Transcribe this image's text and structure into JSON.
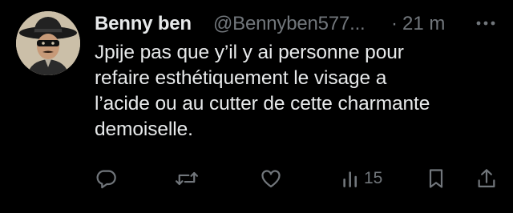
{
  "tweet": {
    "display_name": "Benny ben",
    "handle": "@Bennyben577...",
    "separator": "·",
    "time": "21 m",
    "text": "Jpije pas que y’il y ai personne pour\nrefaire esthétiquement le visage a\nl’acide ou au cutter de cette charmante\ndemoiselle."
  },
  "actions": {
    "reply_icon": "reply-icon",
    "retweet_icon": "retweet-icon",
    "like_icon": "heart-icon",
    "views_icon": "analytics-icon",
    "views_count": "15",
    "bookmark_icon": "bookmark-icon",
    "share_icon": "share-icon"
  },
  "colors": {
    "background": "#000000",
    "primary_text": "#e7e9ea",
    "secondary_text": "#71767b"
  }
}
